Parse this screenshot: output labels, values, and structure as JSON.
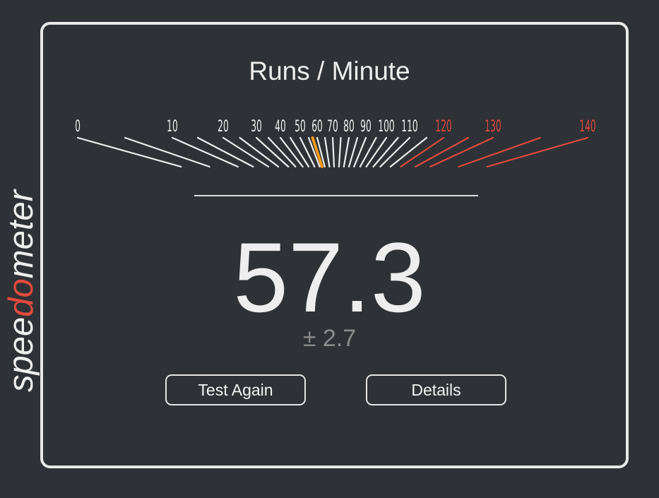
{
  "logo": {
    "prefix": "spee",
    "accent": "do",
    "suffix": "meter",
    "accent_color": "#e04a3f",
    "icon": "speedometer-icon"
  },
  "gauge": {
    "title": "Runs / Minute",
    "min": 0,
    "max": 140,
    "redline_from": 120,
    "labels": [
      "0",
      "10",
      "20",
      "30",
      "40",
      "50",
      "60",
      "70",
      "80",
      "90",
      "100",
      "110",
      "120",
      "130",
      "140"
    ],
    "needle_value": 57.3,
    "colors": {
      "tick": "#eeeeee",
      "redline": "#e04a3f",
      "needle": "#f39a1b"
    }
  },
  "result": {
    "score": "57.3",
    "error": "± 2.7"
  },
  "buttons": {
    "test_again": "Test Again",
    "details": "Details"
  }
}
